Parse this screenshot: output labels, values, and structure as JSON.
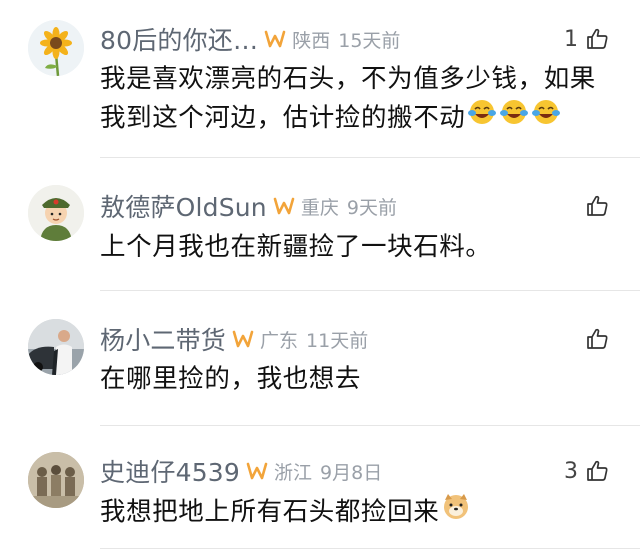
{
  "comments": [
    {
      "username": "80后的你还…",
      "location": "陕西",
      "time": "15天前",
      "likes": "1",
      "text_line1": "我是喜欢漂亮的石头，不为值多少钱，如果",
      "text_line2": "我到这个河边，估计捡的搬不动",
      "avatar_icon": "sunflower-avatar",
      "emojis": [
        "laugh-cry-emoji",
        "laugh-cry-emoji",
        "laugh-cry-emoji"
      ]
    },
    {
      "username": "敖德萨OldSun",
      "location": "重庆",
      "time": "9天前",
      "likes": "",
      "text_line1": "上个月我也在新疆捡了一块石料。",
      "avatar_icon": "soldier-cartoon-avatar"
    },
    {
      "username": "杨小二带货",
      "location": "广东",
      "time": "11天前",
      "likes": "",
      "text_line1": "在哪里捡的，我也想去",
      "avatar_icon": "man-with-car-avatar"
    },
    {
      "username": "史迪仔4539",
      "location": "浙江",
      "time": "9月8日",
      "likes": "3",
      "text_line1": "我想把地上所有石头都捡回来",
      "avatar_icon": "vintage-photo-avatar",
      "emojis": [
        "doge-emoji"
      ]
    }
  ],
  "colors": {
    "username": "#5e6773",
    "meta": "#9aa0a8",
    "vip_badge": "#f2a43a",
    "divider": "#e6e6e6"
  }
}
